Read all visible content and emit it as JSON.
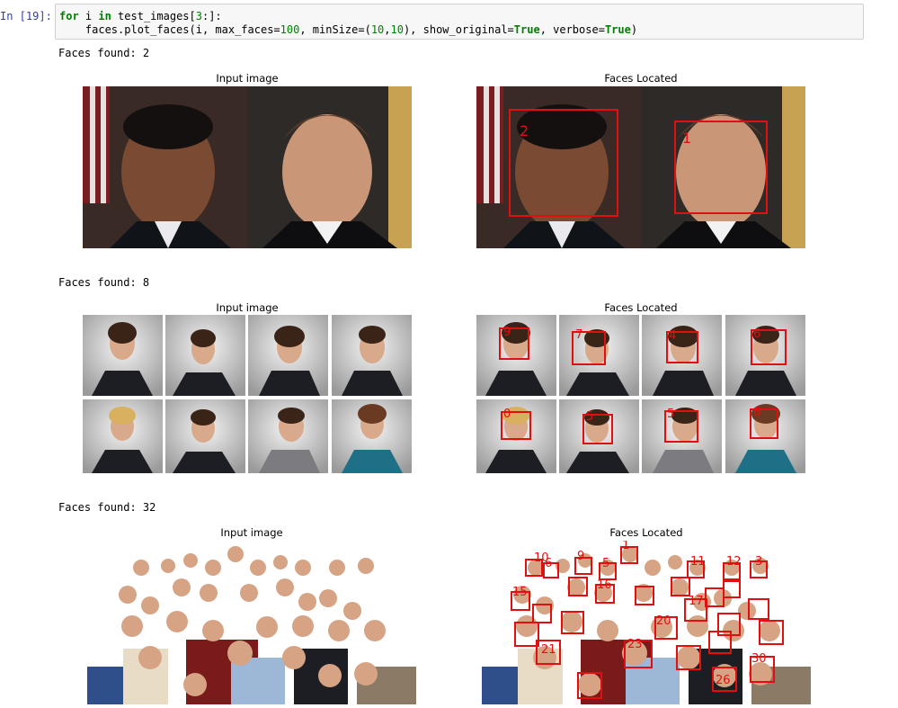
{
  "cell": {
    "prompt": "In [19]:",
    "code_line1_kw1": "for",
    "code_line1_mid": " i ",
    "code_line1_kw2": "in",
    "code_line1_rest": " test_images[",
    "code_line1_num": "3",
    "code_line1_end": ":]:",
    "code_line2_a": "    faces.plot_faces(i, max_faces=",
    "code_line2_n1": "100",
    "code_line2_b": ", minSize=(",
    "code_line2_n2": "10",
    "code_line2_c": ",",
    "code_line2_n3": "10",
    "code_line2_d": "), show_original=",
    "code_line2_t1": "True",
    "code_line2_e": ", verbose=",
    "code_line2_t2": "True",
    "code_line2_f": ")"
  },
  "outputs": [
    {
      "faces_found": "Faces found: 2",
      "left_title": "Input image",
      "right_title": "Faces Located"
    },
    {
      "faces_found": "Faces found: 8",
      "left_title": "Input image",
      "right_title": "Faces Located"
    },
    {
      "faces_found": "Faces found: 32",
      "left_title": "Input image",
      "right_title": "Faces Located"
    }
  ],
  "labels": {
    "set1": [
      "2",
      "1"
    ],
    "set2": [
      "9",
      "7",
      "4",
      "6",
      "0",
      "5",
      "5",
      "6"
    ],
    "set3": [
      "1",
      "10",
      "6",
      "9",
      "5",
      "11",
      "12",
      "3",
      "15",
      "16",
      "20",
      "17",
      "21",
      "23",
      "30",
      "26"
    ]
  },
  "colors": {
    "box": "#e01010",
    "prompt": "#303f9f"
  }
}
